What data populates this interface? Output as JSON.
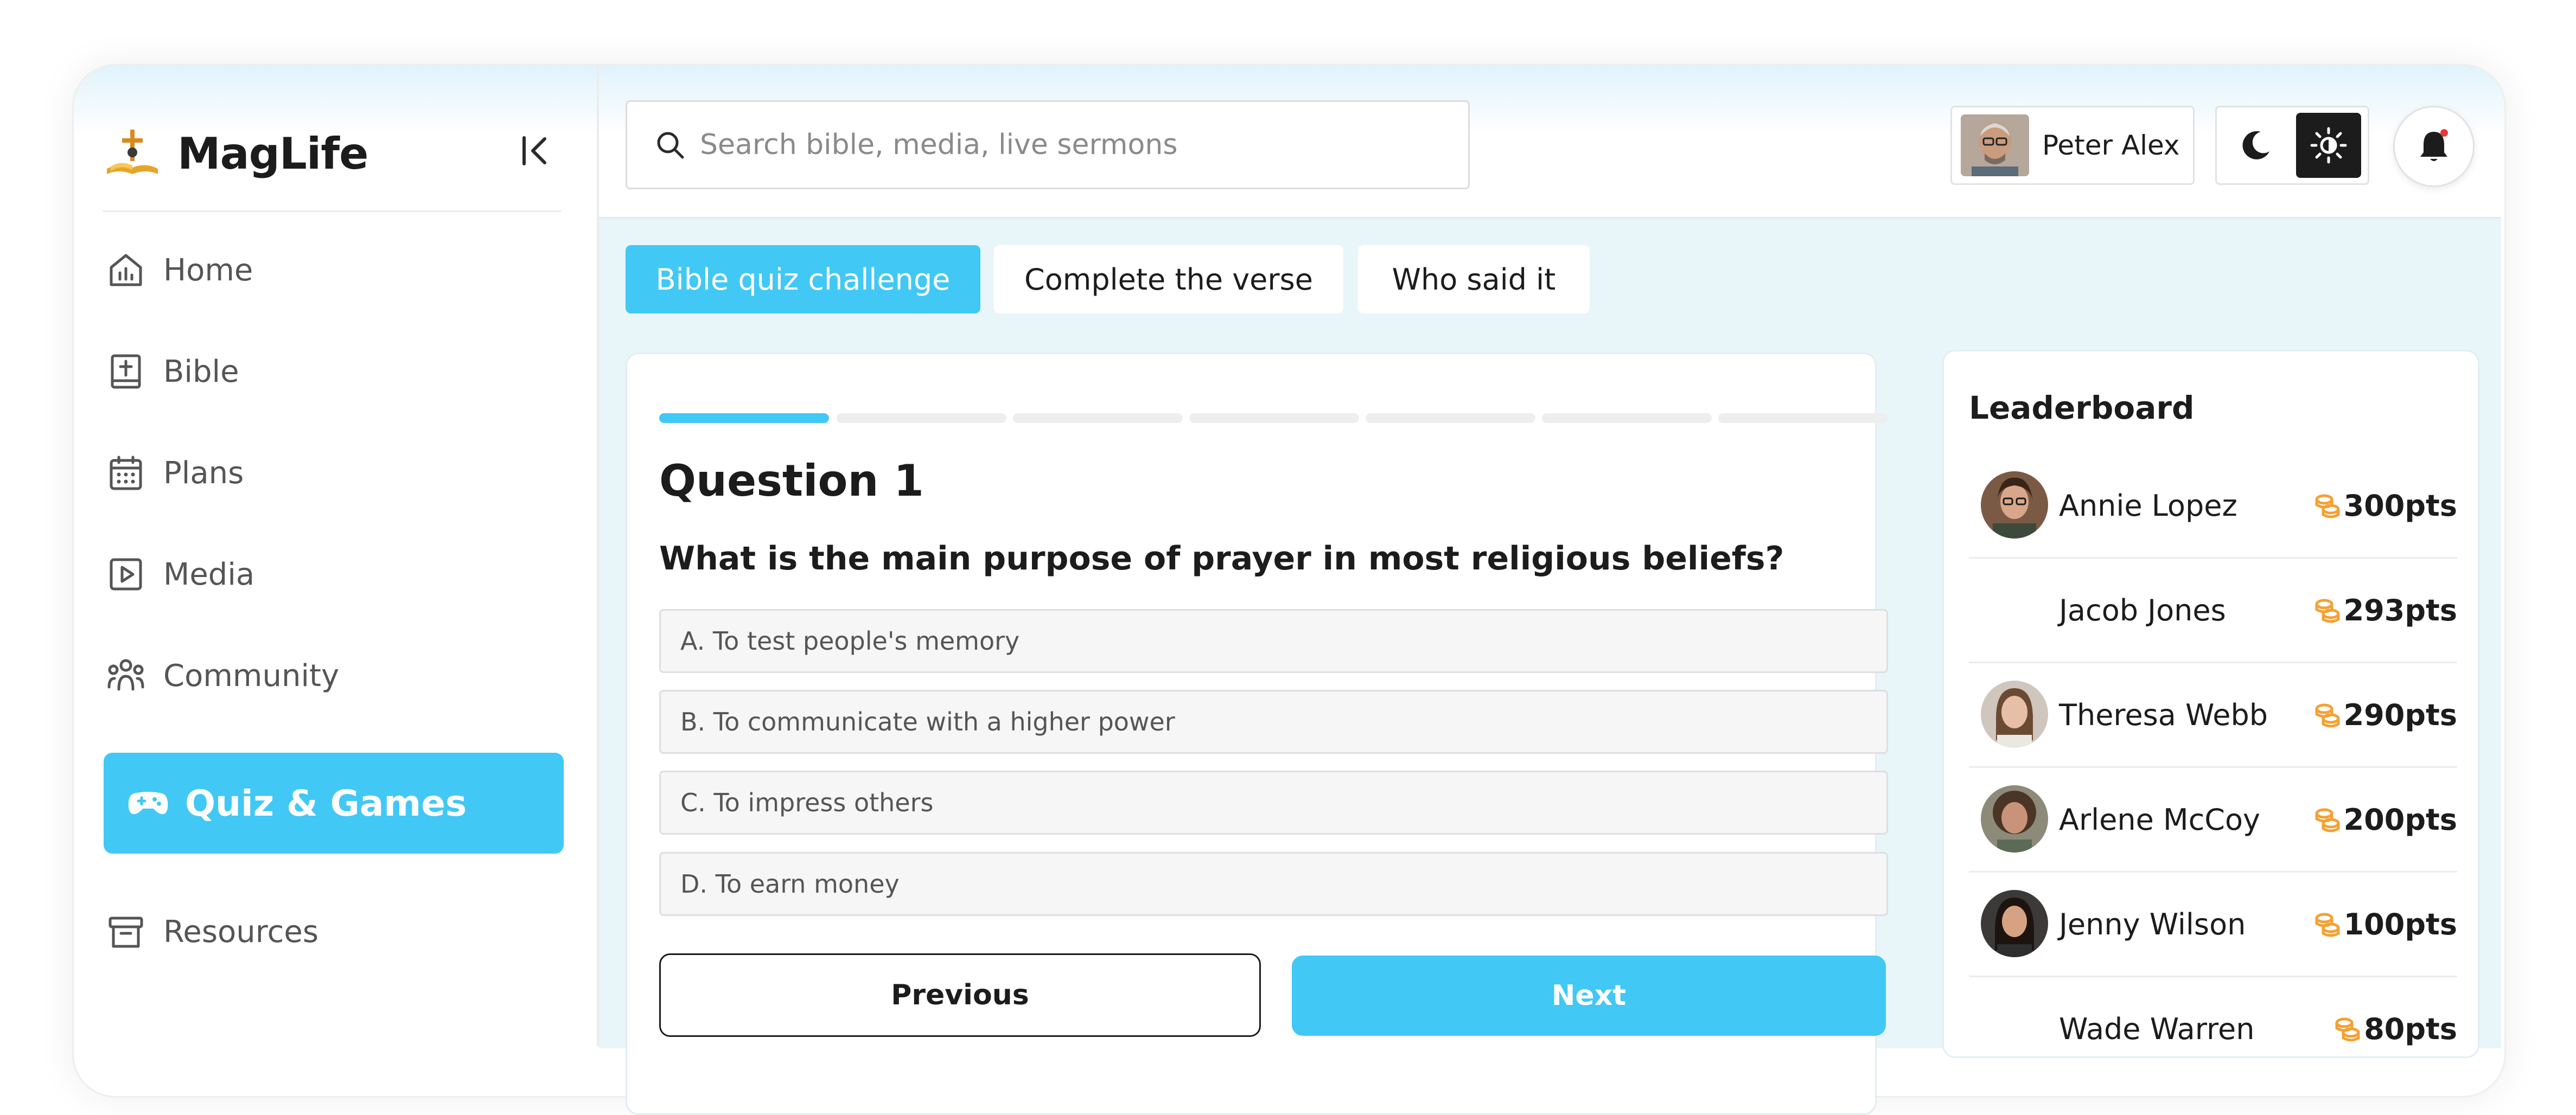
{
  "app": {
    "name": "MagLife"
  },
  "sidebar": {
    "items": [
      {
        "label": "Home",
        "icon": "home-chart-icon"
      },
      {
        "label": "Bible",
        "icon": "bible-icon"
      },
      {
        "label": "Plans",
        "icon": "calendar-icon"
      },
      {
        "label": "Media",
        "icon": "play-icon"
      },
      {
        "label": "Community",
        "icon": "community-icon"
      }
    ],
    "active_item": {
      "label": "Quiz & Games",
      "icon": "gamepad-icon"
    },
    "bottom_item": {
      "label": "Resources",
      "icon": "archive-icon"
    }
  },
  "search": {
    "placeholder": "Search bible, media, live sermons"
  },
  "profile": {
    "name": "Peter Alex"
  },
  "tabs": [
    {
      "label": "Bible quiz challenge",
      "active": true
    },
    {
      "label": "Complete the verse",
      "active": false
    },
    {
      "label": "Who said it",
      "active": false
    }
  ],
  "quiz": {
    "progress": {
      "current": 1,
      "total": 7
    },
    "title": "Question 1",
    "question": "What is the main purpose of prayer in most religious beliefs?",
    "options": [
      "A. To test people's memory",
      "B. To communicate with a higher power",
      "C. To impress others",
      "D. To earn money"
    ],
    "previous_label": "Previous",
    "next_label": "Next"
  },
  "leaderboard": {
    "title": "Leaderboard",
    "entries": [
      {
        "name": "Annie Lopez",
        "points": "300pts",
        "avatar": "woman-glasses"
      },
      {
        "name": "Jacob Jones",
        "points": "293pts",
        "avatar": "none"
      },
      {
        "name": "Theresa Webb",
        "points": "290pts",
        "avatar": "woman-long-hair"
      },
      {
        "name": "Arlene McCoy",
        "points": "200pts",
        "avatar": "woman-curly"
      },
      {
        "name": "Jenny Wilson",
        "points": "100pts",
        "avatar": "woman-dark-hair"
      },
      {
        "name": "Wade Warren",
        "points": "80pts",
        "avatar": "none"
      }
    ]
  },
  "colors": {
    "accent": "#41c8f5",
    "coin": "#f5a031",
    "notification_dot": "#e53935"
  }
}
